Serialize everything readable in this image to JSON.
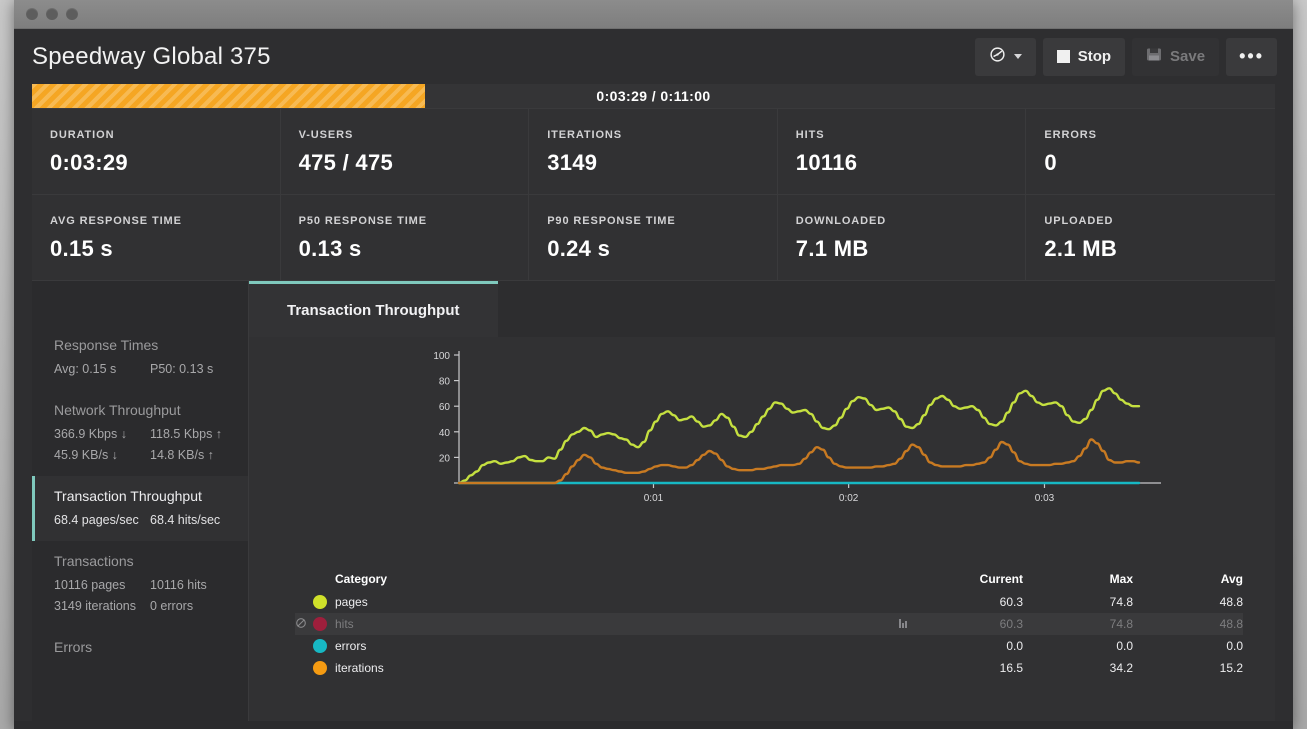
{
  "window": {
    "traffic_dots": [
      "close",
      "minimize",
      "zoom"
    ]
  },
  "header": {
    "title": "Speedway Global 375",
    "buttons": [
      {
        "name": "gauge-dropdown",
        "label": "",
        "icon": "gauge-icon",
        "disabled": false
      },
      {
        "name": "stop",
        "label": "Stop",
        "icon": "stop-square-icon",
        "disabled": false
      },
      {
        "name": "save",
        "label": "Save",
        "icon": "floppy-disk-icon",
        "disabled": true
      },
      {
        "name": "more",
        "label": "•••",
        "icon": "ellipsis-icon",
        "disabled": false
      }
    ]
  },
  "progress": {
    "elapsed": "0:03:29",
    "total": "0:11:00",
    "label": "0:03:29 / 0:11:00",
    "percent": 31.6,
    "fill_color": "#f5a623"
  },
  "metrics": [
    {
      "label": "DURATION",
      "value": "0:03:29"
    },
    {
      "label": "V-USERS",
      "value": "475 / 475"
    },
    {
      "label": "ITERATIONS",
      "value": "3149"
    },
    {
      "label": "HITS",
      "value": "10116"
    },
    {
      "label": "ERRORS",
      "value": "0"
    },
    {
      "label": "AVG RESPONSE TIME",
      "value": "0.15 s"
    },
    {
      "label": "P50 RESPONSE TIME",
      "value": "0.13 s"
    },
    {
      "label": "P90 RESPONSE TIME",
      "value": "0.24 s"
    },
    {
      "label": "DOWNLOADED",
      "value": "7.1 MB"
    },
    {
      "label": "UPLOADED",
      "value": "2.1 MB"
    }
  ],
  "sidebar": {
    "items": [
      {
        "title": "Response Times",
        "active": false,
        "row1": [
          "Avg: 0.15 s",
          "P50: 0.13 s"
        ],
        "row2": [
          "",
          ""
        ]
      },
      {
        "title": "Network Throughput",
        "active": false,
        "row1": [
          "366.9 Kbps ↓",
          "118.5 Kbps ↑"
        ],
        "row2": [
          "45.9 KB/s ↓",
          "14.8 KB/s ↑"
        ]
      },
      {
        "title": "Transaction Throughput",
        "active": true,
        "row1": [
          "68.4 pages/sec",
          "68.4 hits/sec"
        ],
        "row2": [
          "",
          ""
        ]
      },
      {
        "title": "Transactions",
        "active": false,
        "row1": [
          "10116 pages",
          "10116 hits"
        ],
        "row2": [
          "3149 iterations",
          "0 errors"
        ]
      },
      {
        "title": "Errors",
        "active": false,
        "row1": [
          "",
          ""
        ],
        "row2": [
          "",
          ""
        ]
      }
    ]
  },
  "tabs": [
    {
      "label": "Transaction Throughput",
      "active": true
    }
  ],
  "legend": {
    "headers": {
      "category": "Category",
      "current": "Current",
      "max": "Max",
      "avg": "Avg"
    },
    "rows": [
      {
        "name": "pages",
        "color": "#cfe02a",
        "current": "60.3",
        "max": "74.8",
        "avg": "48.8",
        "hidden": false
      },
      {
        "name": "hits",
        "color": "#9e1f3c",
        "current": "60.3",
        "max": "74.8",
        "avg": "48.8",
        "hidden": true
      },
      {
        "name": "errors",
        "color": "#17b8c4",
        "current": "0.0",
        "max": "0.0",
        "avg": "0.0",
        "hidden": false
      },
      {
        "name": "iterations",
        "color": "#f59b12",
        "current": "16.5",
        "max": "34.2",
        "avg": "15.2",
        "hidden": false
      }
    ]
  },
  "chart_data": {
    "type": "line",
    "title": "Transaction Throughput",
    "xlabel": "",
    "ylabel": "",
    "ylim": [
      0,
      100
    ],
    "yticks": [
      0,
      20,
      40,
      60,
      80,
      100
    ],
    "ytick_labels": [
      "",
      "20",
      "40",
      "60",
      "80",
      "100"
    ],
    "xticks": [
      "0:01",
      "0:02",
      "0:03"
    ],
    "xtick_positions": [
      0.286,
      0.573,
      0.861
    ],
    "grid": false,
    "legend_position": "below",
    "series": [
      {
        "name": "pages",
        "color": "#c5e040",
        "values": [
          0,
          2,
          6,
          9,
          14,
          16,
          17,
          15,
          16,
          17,
          20,
          21,
          18,
          17,
          17,
          20,
          19,
          26,
          33,
          38,
          40,
          43,
          41,
          36,
          38,
          39,
          38,
          35,
          34,
          30,
          28,
          32,
          41,
          48,
          54,
          56,
          53,
          49,
          50,
          52,
          48,
          44,
          45,
          49,
          54,
          51,
          44,
          37,
          36,
          40,
          46,
          52,
          58,
          63,
          62,
          58,
          55,
          56,
          57,
          54,
          48,
          43,
          42,
          45,
          51,
          58,
          64,
          67,
          66,
          61,
          57,
          58,
          59,
          56,
          50,
          44,
          43,
          46,
          53,
          61,
          66,
          68,
          65,
          60,
          58,
          59,
          60,
          57,
          51,
          46,
          45,
          48,
          55,
          63,
          70,
          72,
          68,
          63,
          61,
          62,
          63,
          60,
          53,
          48,
          47,
          50,
          57,
          65,
          72,
          74,
          70,
          65,
          62,
          60,
          60
        ]
      },
      {
        "name": "hits",
        "color": "#9e1f3c",
        "values": [],
        "hidden": true
      },
      {
        "name": "errors",
        "color": "#17b8c4",
        "values": [
          0,
          0,
          0,
          0,
          0,
          0,
          0,
          0,
          0,
          0,
          0,
          0,
          0,
          0,
          0,
          0,
          0,
          0,
          0,
          0,
          0,
          0,
          0,
          0,
          0,
          0,
          0,
          0,
          0,
          0,
          0,
          0,
          0,
          0,
          0,
          0,
          0,
          0,
          0,
          0,
          0,
          0,
          0,
          0,
          0,
          0,
          0,
          0,
          0,
          0,
          0,
          0,
          0,
          0,
          0,
          0,
          0,
          0,
          0,
          0,
          0,
          0,
          0,
          0,
          0,
          0,
          0,
          0,
          0,
          0,
          0,
          0,
          0,
          0,
          0,
          0,
          0,
          0,
          0,
          0,
          0,
          0,
          0,
          0,
          0,
          0,
          0,
          0,
          0,
          0,
          0,
          0,
          0,
          0,
          0,
          0,
          0,
          0,
          0,
          0,
          0,
          0,
          0,
          0,
          0,
          0,
          0,
          0,
          0,
          0,
          0,
          0,
          0,
          0,
          0
        ]
      },
      {
        "name": "iterations",
        "color": "#c87a22",
        "values": [
          0,
          0,
          0,
          0,
          0,
          0,
          0,
          0,
          0,
          0,
          0,
          0,
          0,
          0,
          0,
          0,
          0,
          2,
          7,
          13,
          18,
          22,
          20,
          15,
          12,
          11,
          10,
          9,
          8,
          8,
          8,
          9,
          11,
          13,
          14,
          14,
          13,
          12,
          12,
          14,
          18,
          22,
          25,
          23,
          18,
          13,
          11,
          10,
          10,
          10,
          11,
          11,
          12,
          13,
          14,
          14,
          14,
          15,
          19,
          24,
          28,
          26,
          20,
          15,
          13,
          12,
          12,
          12,
          12,
          12,
          13,
          13,
          14,
          15,
          19,
          25,
          30,
          28,
          22,
          16,
          14,
          13,
          13,
          13,
          13,
          14,
          14,
          15,
          16,
          20,
          26,
          32,
          30,
          24,
          17,
          15,
          14,
          14,
          14,
          14,
          15,
          15,
          16,
          17,
          21,
          27,
          34,
          31,
          25,
          18,
          16,
          16,
          17,
          17,
          16
        ]
      }
    ]
  }
}
